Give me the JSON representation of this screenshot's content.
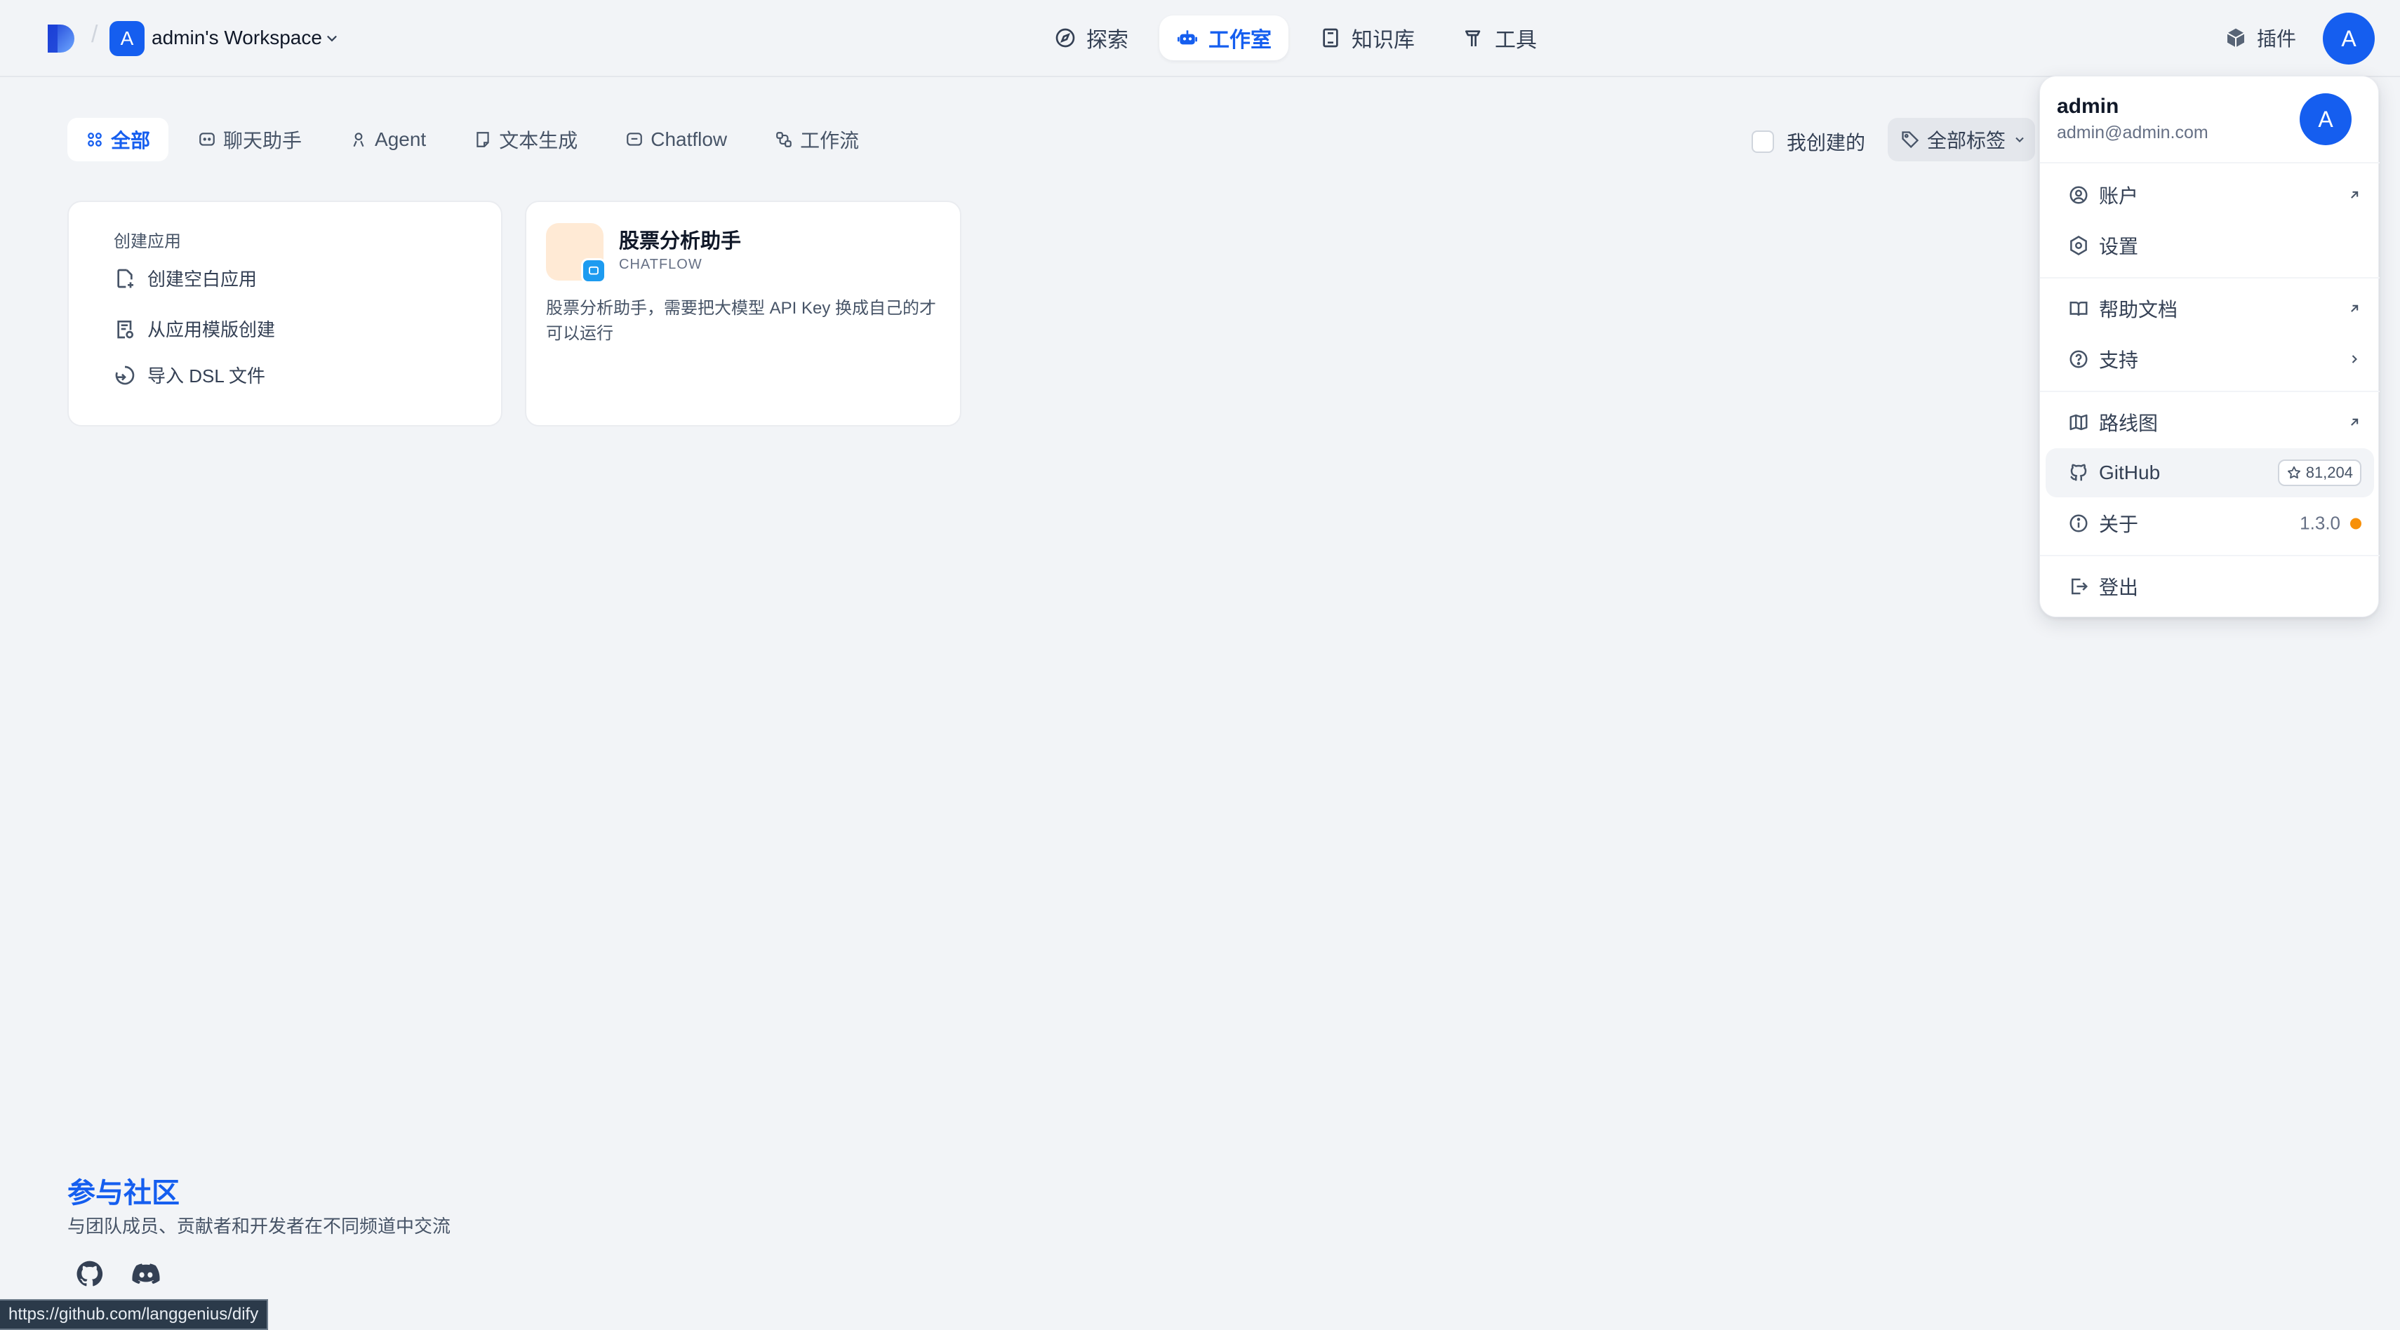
{
  "header": {
    "workspace_initial": "A",
    "workspace_name": "admin's Workspace",
    "nav": [
      {
        "label": "探索",
        "icon": "compass-icon"
      },
      {
        "label": "工作室",
        "icon": "robot-icon",
        "active": true
      },
      {
        "label": "知识库",
        "icon": "book-icon"
      },
      {
        "label": "工具",
        "icon": "hammer-icon"
      }
    ],
    "plugins_label": "插件",
    "avatar_initial": "A"
  },
  "filters": {
    "tabs": [
      {
        "label": "全部",
        "active": true
      },
      {
        "label": "聊天助手"
      },
      {
        "label": "Agent"
      },
      {
        "label": "文本生成"
      },
      {
        "label": "Chatflow"
      },
      {
        "label": "工作流"
      }
    ],
    "mine_label": "我创建的",
    "tag_label": "全部标签"
  },
  "create_card": {
    "title": "创建应用",
    "items": [
      "创建空白应用",
      "从应用模版创建",
      "导入 DSL 文件"
    ]
  },
  "app_card": {
    "name": "股票分析助手",
    "type": "CHATFLOW",
    "description": "股票分析助手，需要把大模型 API Key 换成自己的才可以运行"
  },
  "community": {
    "title": "参与社区",
    "subtitle": "与团队成员、贡献者和开发者在不同频道中交流"
  },
  "status_bar_url": "https://github.com/langgenius/dify",
  "menu": {
    "user_name": "admin",
    "user_email": "admin@admin.com",
    "avatar_initial": "A",
    "items": {
      "account": "账户",
      "settings": "设置",
      "help_docs": "帮助文档",
      "support": "支持",
      "roadmap": "路线图",
      "github": "GitHub",
      "github_stars": "81,204",
      "about": "关于",
      "version": "1.3.0",
      "logout": "登出"
    }
  },
  "colors": {
    "accent": "#155eef",
    "background": "#f2f4f7",
    "update_dot": "#f79009"
  }
}
